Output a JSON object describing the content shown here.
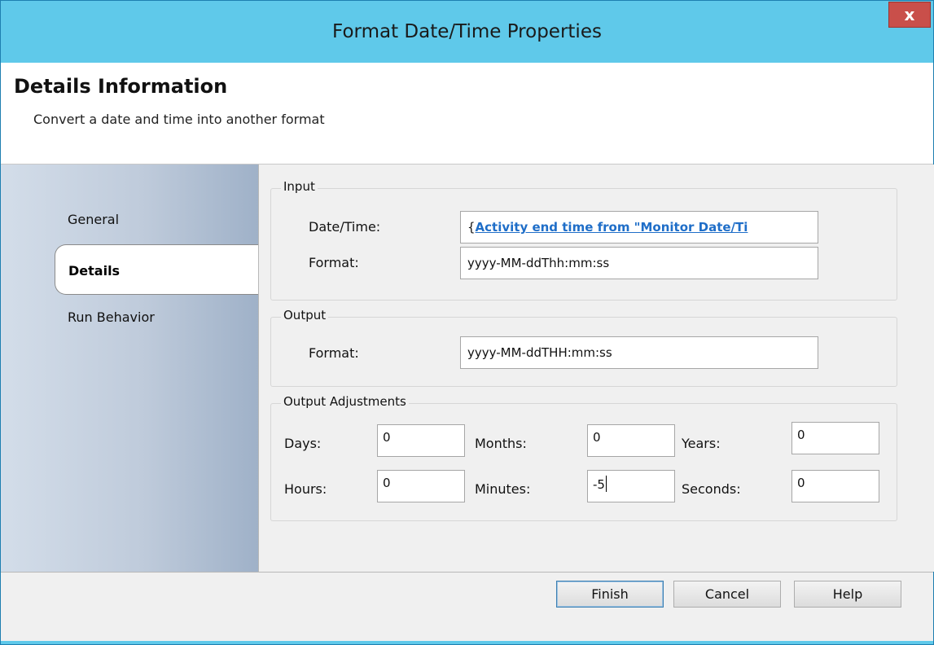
{
  "window": {
    "title": "Format Date/Time Properties",
    "close_glyph": "x"
  },
  "header": {
    "title": "Details Information",
    "subtitle": "Convert a date and time into another format"
  },
  "nav": {
    "items": [
      {
        "label": "General",
        "active": false
      },
      {
        "label": "Details",
        "active": true
      },
      {
        "label": "Run Behavior",
        "active": false
      }
    ]
  },
  "input": {
    "label": "Input",
    "datetime_label": "Date/Time:",
    "datetime_prefix": "{",
    "datetime_value": "Activity end time from \"Monitor Date/Ti",
    "format_label": "Format:",
    "format_value": "yyyy-MM-ddThh:mm:ss"
  },
  "output": {
    "label": "Output",
    "format_label": "Format:",
    "format_value": "yyyy-MM-ddTHH:mm:ss"
  },
  "adjustments": {
    "label": "Output Adjustments",
    "days_label": "Days:",
    "days_value": "0",
    "months_label": "Months:",
    "months_value": "0",
    "years_label": "Years:",
    "years_value": "0",
    "hours_label": "Hours:",
    "hours_value": "0",
    "minutes_label": "Minutes:",
    "minutes_value": "-5",
    "seconds_label": "Seconds:",
    "seconds_value": "0"
  },
  "buttons": {
    "finish": "Finish",
    "cancel": "Cancel",
    "help": "Help"
  },
  "colors": {
    "titlebar": "#5fc9ea",
    "close": "#c94f4a",
    "link": "#1f6ec8"
  }
}
